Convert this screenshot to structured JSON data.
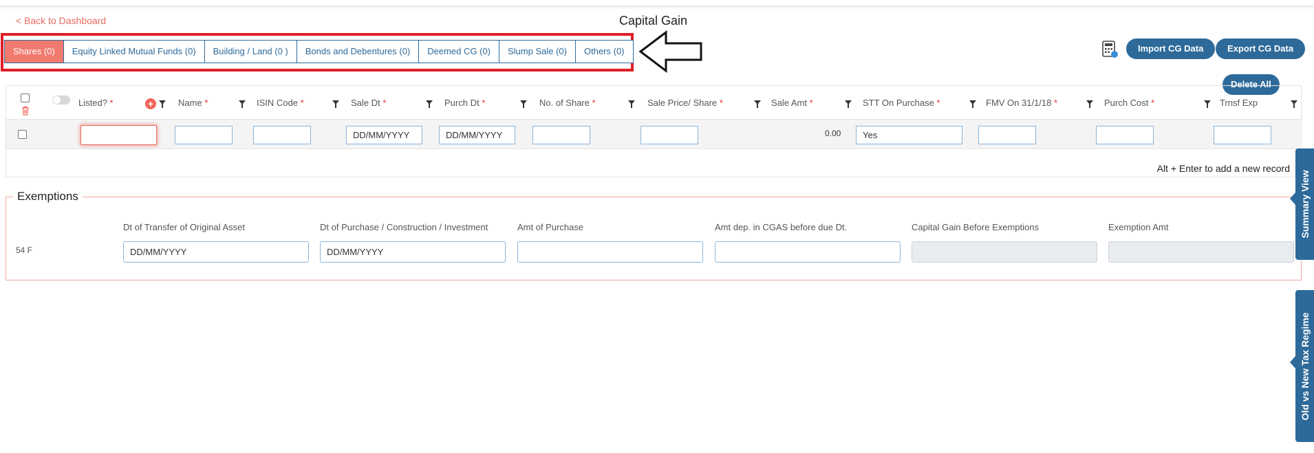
{
  "nav": {
    "back_label": "< Back to Dashboard"
  },
  "page": {
    "title": "Capital Gain"
  },
  "tabs": [
    {
      "label": "Shares (0)",
      "active": true
    },
    {
      "label": "Equity Linked Mutual Funds (0)"
    },
    {
      "label": "Building / Land (0 )"
    },
    {
      "label": "Bonds and Debentures (0)"
    },
    {
      "label": "Deemed CG (0)"
    },
    {
      "label": "Slump Sale (0)"
    },
    {
      "label": "Others (0)"
    }
  ],
  "actions": {
    "import_label": "Import CG Data",
    "export_label": "Export CG Data",
    "delete_all_label": "Delete All"
  },
  "grid": {
    "columns": [
      {
        "label": "Listed?",
        "required": "*"
      },
      {
        "label": "Name",
        "required": "*"
      },
      {
        "label": "ISIN Code",
        "required": "*"
      },
      {
        "label": "Sale Dt",
        "required": "*"
      },
      {
        "label": "Purch Dt",
        "required": "*"
      },
      {
        "label": "No. of Share",
        "required": "*"
      },
      {
        "label": "Sale Price/ Share",
        "required": "*"
      },
      {
        "label": "Sale Amt",
        "required": "*"
      },
      {
        "label": "STT On Purchase",
        "required": "*"
      },
      {
        "label": "FMV On 31/1/18",
        "required": "*"
      },
      {
        "label": "Purch Cost",
        "required": "*"
      },
      {
        "label": "Trnsf Exp",
        "required": ""
      }
    ],
    "row": {
      "sale_dt_placeholder": "DD/MM/YYYY",
      "purch_dt_placeholder": "DD/MM/YYYY",
      "sale_amt": "0.00",
      "stt_value": "Yes"
    },
    "hint": "Alt + Enter to add a new record"
  },
  "exemptions": {
    "title": "Exemptions",
    "row_label": "54 F",
    "fields": [
      {
        "label": "Dt of Transfer of Original Asset",
        "placeholder": "DD/MM/YYYY"
      },
      {
        "label": "Dt of Purchase / Construction / Investment",
        "placeholder": "DD/MM/YYYY"
      },
      {
        "label": "Amt of Purchase",
        "placeholder": ""
      },
      {
        "label": "Amt dep. in CGAS before due Dt.",
        "placeholder": ""
      },
      {
        "label": "Capital Gain Before Exemptions",
        "placeholder": ""
      },
      {
        "label": "Exemption Amt",
        "placeholder": ""
      }
    ]
  },
  "side_tabs": {
    "summary_label": "Summary View",
    "regime_label": "Old vs New Tax Regime"
  },
  "colors": {
    "primary": "#2d6a9a",
    "accent": "#f17a6f",
    "highlight": "#e01e26"
  }
}
